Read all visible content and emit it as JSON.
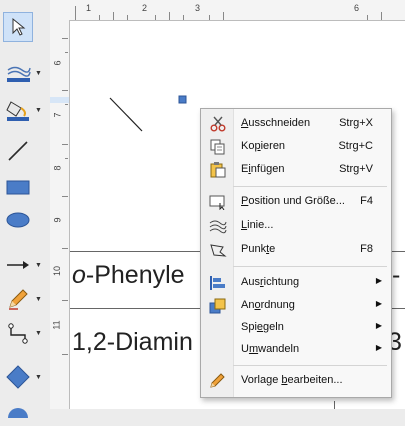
{
  "toolbar": {
    "tools": [
      {
        "name": "select",
        "icon": "select-arrow-icon",
        "has_dropdown": false
      },
      {
        "name": "line-color",
        "icon": "line-color-icon",
        "has_dropdown": true
      },
      {
        "name": "fill-color",
        "icon": "fill-bucket-icon",
        "has_dropdown": true
      },
      {
        "name": "line",
        "icon": "line-icon",
        "has_dropdown": false
      },
      {
        "name": "rectangle",
        "icon": "rectangle-icon",
        "has_dropdown": false
      },
      {
        "name": "ellipse",
        "icon": "ellipse-icon",
        "has_dropdown": false
      },
      {
        "name": "arrow-lines",
        "icon": "arrow-line-icon",
        "has_dropdown": true
      },
      {
        "name": "curves",
        "icon": "pencil-icon",
        "has_dropdown": true
      },
      {
        "name": "connectors",
        "icon": "connector-icon",
        "has_dropdown": true
      },
      {
        "name": "basic-shapes",
        "icon": "diamond-icon",
        "has_dropdown": true
      }
    ]
  },
  "ruler_top": {
    "labels": [
      "1",
      "2",
      "3",
      "6"
    ]
  },
  "ruler_left": {
    "labels": [
      "6",
      "7",
      "8",
      "9",
      "10",
      "11"
    ]
  },
  "canvas": {
    "row1_prefix": "o",
    "row1_text": "-Phenyle",
    "row1_tail": "-",
    "row2_text": "1,2-Diamin",
    "row2_tail": "3"
  },
  "context_menu": {
    "items": [
      {
        "label": "Ausschneiden",
        "mnemonic_index": 0,
        "shortcut": "Strg+X",
        "icon": "scissors-icon",
        "submenu": false
      },
      {
        "label": "Kopieren",
        "mnemonic_index": 2,
        "shortcut": "Strg+C",
        "icon": "copy-icon",
        "submenu": false
      },
      {
        "label": "Einfügen",
        "mnemonic_index": 1,
        "shortcut": "Strg+V",
        "icon": "paste-icon",
        "submenu": false
      },
      {
        "label": "Position und Größe...",
        "mnemonic_index": 0,
        "shortcut": "F4",
        "icon": "position-size-icon",
        "submenu": false
      },
      {
        "label": "Linie...",
        "mnemonic_index": 0,
        "shortcut": "",
        "icon": "line-style-icon",
        "submenu": false
      },
      {
        "label": "Punkte",
        "mnemonic_index": 4,
        "shortcut": "F8",
        "icon": "points-icon",
        "submenu": false
      },
      {
        "label": "Ausrichtung",
        "mnemonic_index": 3,
        "shortcut": "",
        "icon": "align-icon",
        "submenu": true
      },
      {
        "label": "Anordnung",
        "mnemonic_index": 2,
        "shortcut": "",
        "icon": "arrange-icon",
        "submenu": true
      },
      {
        "label": "Spiegeln",
        "mnemonic_index": 3,
        "shortcut": "",
        "icon": "",
        "submenu": true
      },
      {
        "label": "Umwandeln",
        "mnemonic_index": 1,
        "shortcut": "",
        "icon": "",
        "submenu": true
      },
      {
        "label": "Vorlage bearbeiten...",
        "mnemonic_index": 8,
        "shortcut": "",
        "icon": "edit-template-pencil-icon",
        "submenu": false
      }
    ]
  }
}
